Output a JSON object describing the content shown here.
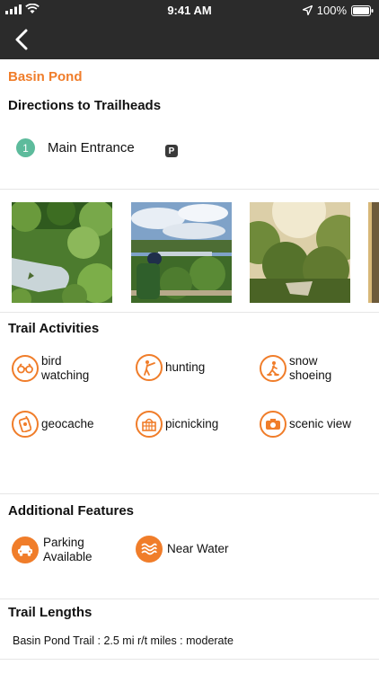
{
  "status_bar": {
    "time": "9:41 AM",
    "battery": "100%"
  },
  "nav": {
    "back_icon": "chevron-left-icon"
  },
  "park": {
    "name": "Basin Pond"
  },
  "directions": {
    "title": "Directions to Trailheads",
    "entrances": [
      {
        "number": "1",
        "label": "Main Entrance",
        "badge": "P"
      }
    ]
  },
  "photos": [
    {
      "alt": "pond with green vegetation"
    },
    {
      "alt": "person overlooking lake and forest"
    },
    {
      "alt": "forest trail with sunlight"
    }
  ],
  "activities": {
    "title": "Trail Activities",
    "items": [
      {
        "line1": "bird",
        "line2": "watching",
        "icon": "binoculars-icon"
      },
      {
        "line1": "hunting",
        "line2": "",
        "icon": "hunter-icon"
      },
      {
        "line1": "snow",
        "line2": "shoeing",
        "icon": "snowshoe-icon"
      },
      {
        "line1": "geocache",
        "line2": "",
        "icon": "gps-device-icon"
      },
      {
        "line1": "picnicking",
        "line2": "",
        "icon": "picnic-basket-icon"
      },
      {
        "line1": "scenic view",
        "line2": "",
        "icon": "camera-icon"
      }
    ]
  },
  "features": {
    "title": "Additional Features",
    "items": [
      {
        "line1": "Parking",
        "line2": "Available",
        "icon": "car-icon"
      },
      {
        "line1": "Near Water",
        "line2": "",
        "icon": "water-waves-icon"
      }
    ]
  },
  "lengths": {
    "title": "Trail Lengths",
    "items": [
      {
        "text": "Basin Pond Trail : 2.5 mi r/t miles : moderate"
      }
    ]
  },
  "colors": {
    "accent": "#f07d2a",
    "nav_bg": "#2b2b2b",
    "marker": "#5dbb9c"
  }
}
